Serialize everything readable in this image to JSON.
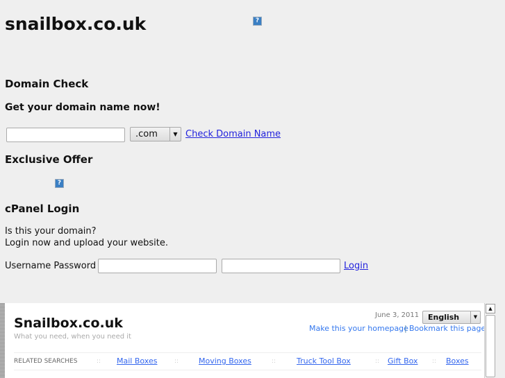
{
  "site_title": "snailbox.co.uk",
  "domain_check": {
    "heading": "Domain Check",
    "subheading": "Get your domain name now!",
    "domain_value": "",
    "tld": ".com",
    "check_link": "Check Domain Name"
  },
  "exclusive_offer": {
    "heading": "Exclusive Offer"
  },
  "cpanel": {
    "heading": "cPanel Login",
    "line1": "Is this your domain?",
    "line2": "Login now and upload your website.",
    "label": "Username Password",
    "username": "",
    "password": "",
    "login_link": "Login"
  },
  "frame": {
    "title": "Snailbox.co.uk",
    "tagline": "What you need, when you need it",
    "date": "June 3, 2011",
    "language": "English",
    "homepage_link": "Make this your homepage",
    "separator": "|",
    "bookmark_link": "Bookmark this page",
    "related_label": "RELATED SEARCHES",
    "related_sep": "::",
    "related": [
      "Mail Boxes",
      "Moving Boxes",
      "Truck Tool Box",
      "Gift Box",
      "Boxes"
    ]
  }
}
